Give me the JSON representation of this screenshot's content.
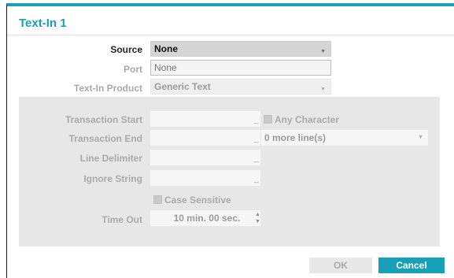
{
  "dialog": {
    "title": "Text-In 1",
    "fields": {
      "source": {
        "label": "Source",
        "value": "None"
      },
      "port": {
        "label": "Port",
        "placeholder": "None"
      },
      "product": {
        "label": "Text-In Product",
        "value": "Generic Text"
      }
    },
    "panel": {
      "transaction_start": {
        "label": "Transaction Start",
        "value": ""
      },
      "any_character": {
        "label": "Any Character",
        "checked": false
      },
      "transaction_end": {
        "label": "Transaction End",
        "value": ""
      },
      "more_lines": {
        "value": "0 more line(s)"
      },
      "line_delimiter": {
        "label": "Line Delimiter",
        "value": ""
      },
      "ignore_string": {
        "label": "Ignore String",
        "value": ""
      },
      "case_sensitive": {
        "label": "Case Sensitive",
        "checked": false
      },
      "time_out": {
        "label": "Time Out",
        "value": "10 min. 00 sec."
      }
    },
    "buttons": {
      "ok": "OK",
      "cancel": "Cancel"
    }
  }
}
